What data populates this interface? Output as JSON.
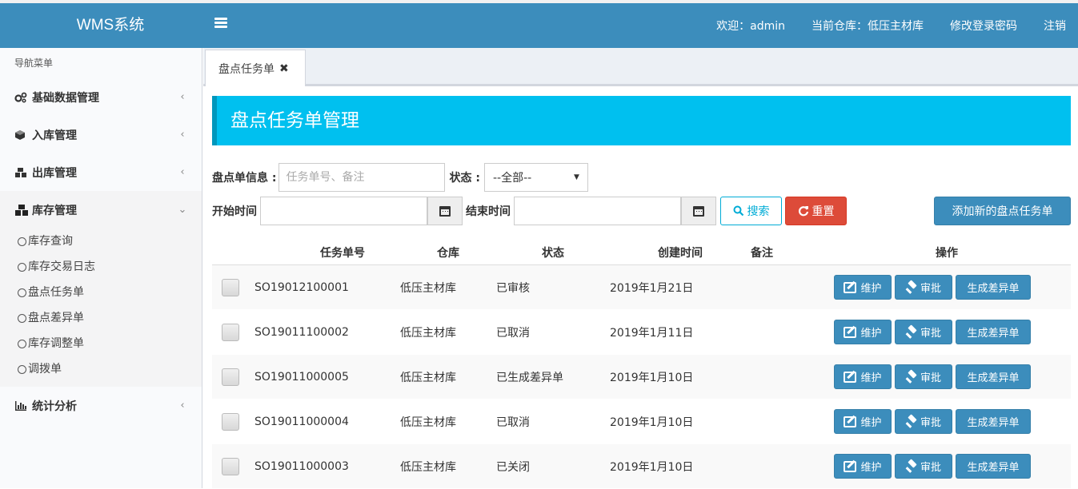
{
  "header": {
    "brand": "WMS系统",
    "welcome": "欢迎：admin",
    "warehouse": "当前仓库：低压主材库",
    "change_password": "修改登录密码",
    "logout": "注销"
  },
  "sidebar": {
    "nav_header": "导航菜单",
    "items": [
      {
        "label": "基础数据管理",
        "icon": "cogs-icon",
        "expanded": false
      },
      {
        "label": "入库管理",
        "icon": "cube-icon",
        "expanded": false
      },
      {
        "label": "出库管理",
        "icon": "cubes-icon",
        "expanded": false
      },
      {
        "label": "库存管理",
        "icon": "cubes-icon",
        "expanded": true
      },
      {
        "label": "统计分析",
        "icon": "bar-chart-icon",
        "expanded": false
      }
    ],
    "subitems": [
      "库存查询",
      "库存交易日志",
      "盘点任务单",
      "盘点差异单",
      "库存调整单",
      "调拨单"
    ]
  },
  "tabs": [
    {
      "label": "盘点任务单"
    }
  ],
  "page_title": "盘点任务单管理",
  "filters": {
    "info_label": "盘点单信息 :",
    "info_placeholder": "任务单号、备注",
    "info_value": "",
    "status_label": "状态 :",
    "status_selected": "--全部--",
    "start_label": "开始时间",
    "start_value": "",
    "end_label": "结束时间",
    "end_value": "",
    "search_label": "搜索",
    "reset_label": "重置",
    "add_label": "添加新的盘点任务单"
  },
  "table": {
    "columns": [
      "任务单号",
      "仓库",
      "状态",
      "创建时间",
      "备注",
      "操作"
    ],
    "rows": [
      {
        "no": "SO19012100001",
        "warehouse": "低压主材库",
        "status": "已审核",
        "created": "2019年1月21日",
        "remark": ""
      },
      {
        "no": "SO19011100002",
        "warehouse": "低压主材库",
        "status": "已取消",
        "created": "2019年1月11日",
        "remark": ""
      },
      {
        "no": "SO19011000005",
        "warehouse": "低压主材库",
        "status": "已生成差异单",
        "created": "2019年1月10日",
        "remark": ""
      },
      {
        "no": "SO19011000004",
        "warehouse": "低压主材库",
        "status": "已取消",
        "created": "2019年1月10日",
        "remark": ""
      },
      {
        "no": "SO19011000003",
        "warehouse": "低压主材库",
        "status": "已关闭",
        "created": "2019年1月10日",
        "remark": ""
      }
    ],
    "actions": {
      "maintain": "维护",
      "approve": "审批",
      "generate_diff": "生成差异单"
    }
  },
  "colors": {
    "header": "#3c8dbc",
    "title": "#00c0ef",
    "reset": "#dd4b39",
    "primary": "#3c8dbc"
  }
}
